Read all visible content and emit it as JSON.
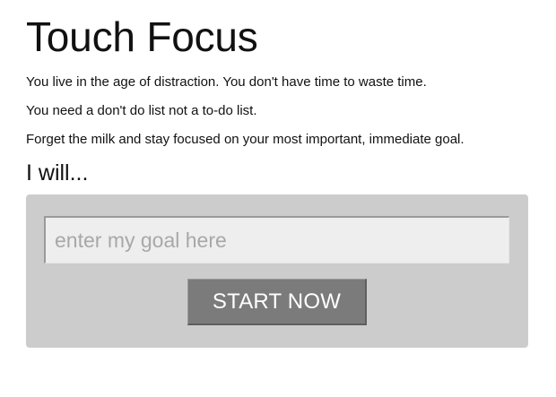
{
  "header": {
    "title": "Touch Focus"
  },
  "intro": {
    "lines": [
      "You live in the age of distraction. You don't have time to waste time.",
      "You need a don't do list not a to-do list.",
      "Forget the milk and stay focused on your most important, immediate goal."
    ]
  },
  "goal_form": {
    "heading": "I will...",
    "input_value": "",
    "input_placeholder": "enter my goal here",
    "submit_label": "START NOW"
  },
  "colors": {
    "panel_background": "#cccccc",
    "input_background": "#eeeeee",
    "button_background": "#7b7b7b",
    "button_text": "#ffffff",
    "text": "#111111"
  }
}
